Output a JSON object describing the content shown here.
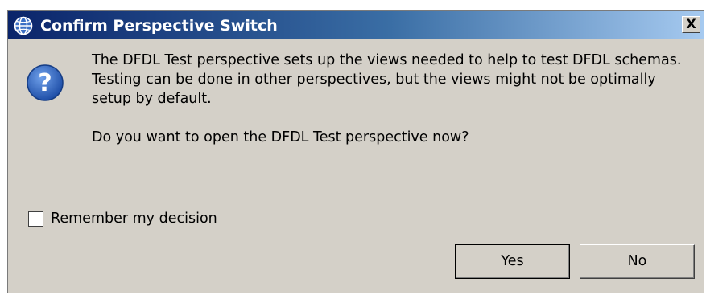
{
  "dialog": {
    "title": "Confirm Perspective Switch",
    "title_icon": "globe-icon",
    "close_label": "X",
    "message_icon": "question-icon",
    "message": "The DFDL Test perspective sets up the views needed to help to test DFDL schemas. Testing can be done in other perspectives, but the views might not be optimally setup by default.",
    "question": "Do you want to open the DFDL Test perspective now?",
    "remember_label": "Remember my decision",
    "remember_checked": false,
    "buttons": {
      "yes_label": "Yes",
      "no_label": "No"
    }
  },
  "colors": {
    "titlebar_start": "#0a246a",
    "titlebar_end": "#a6caf0",
    "dialog_bg": "#d4d0c8",
    "question_icon": "#1f4fa8"
  }
}
